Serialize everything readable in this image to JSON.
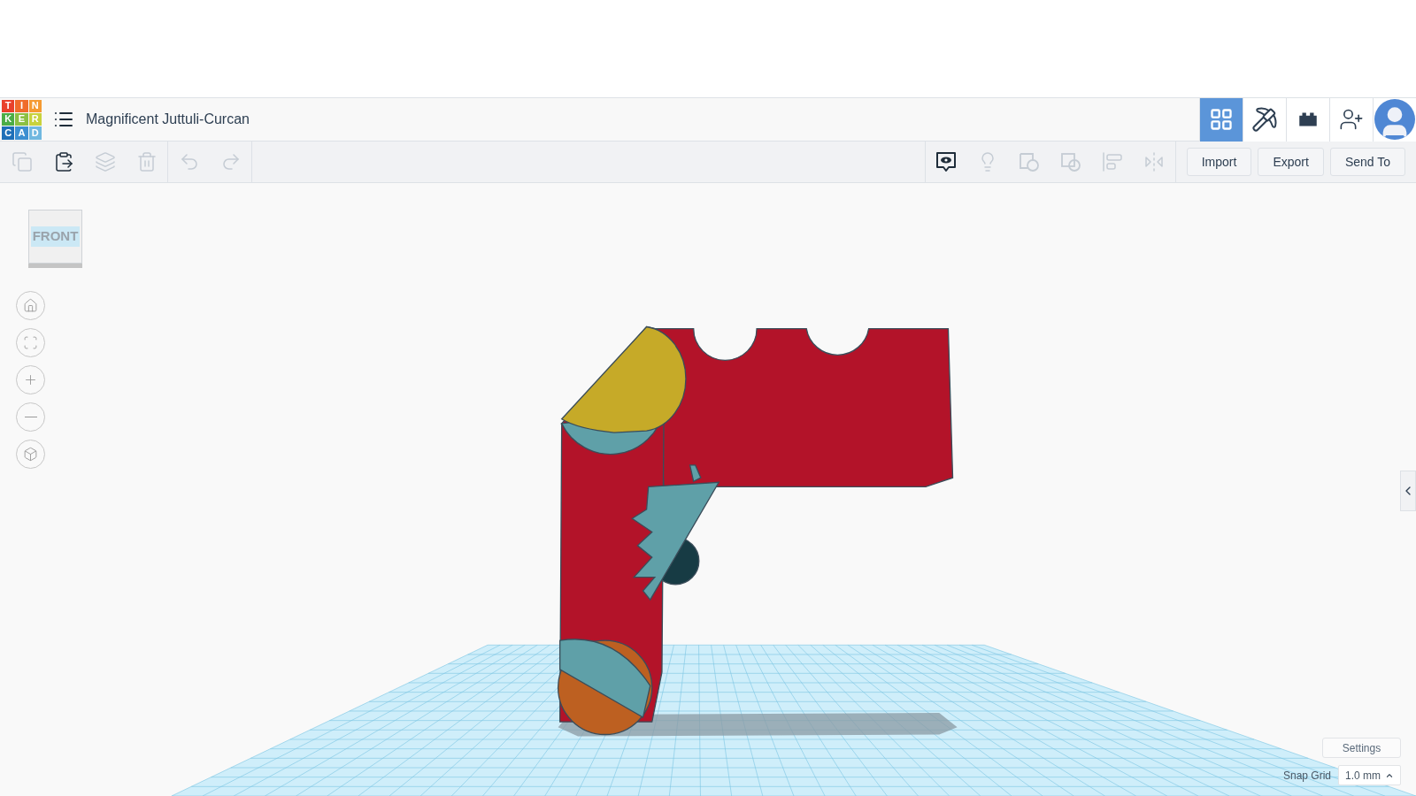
{
  "logo": {
    "tiles": [
      {
        "letter": "T",
        "color": "#e9412b"
      },
      {
        "letter": "I",
        "color": "#f06b2b"
      },
      {
        "letter": "N",
        "color": "#f59a32"
      },
      {
        "letter": "K",
        "color": "#4cad47"
      },
      {
        "letter": "E",
        "color": "#8cc043"
      },
      {
        "letter": "R",
        "color": "#c8d23c"
      },
      {
        "letter": "C",
        "color": "#1e6fb8"
      },
      {
        "letter": "A",
        "color": "#3d8fd1"
      },
      {
        "letter": "D",
        "color": "#70b8e0"
      }
    ]
  },
  "project_title": "Magnificent Juttuli-Curcan",
  "nav": [
    {
      "kind": "grid",
      "selected": true
    },
    {
      "kind": "pickaxe",
      "selected": false
    },
    {
      "kind": "brick",
      "selected": false
    },
    {
      "kind": "add-user",
      "selected": false
    },
    {
      "kind": "avatar",
      "selected": false
    }
  ],
  "edit_tools": [
    {
      "kind": "copy",
      "disabled": true
    },
    {
      "kind": "paste",
      "disabled": false
    },
    {
      "kind": "duplicate",
      "disabled": true
    },
    {
      "kind": "delete",
      "disabled": true
    },
    {
      "kind": "undo",
      "disabled": true
    },
    {
      "kind": "redo",
      "disabled": true
    }
  ],
  "shape_tools": [
    {
      "kind": "notes",
      "disabled": false
    },
    {
      "kind": "light",
      "disabled": true
    },
    {
      "kind": "group",
      "disabled": true
    },
    {
      "kind": "ungroup",
      "disabled": true
    },
    {
      "kind": "align",
      "disabled": true
    },
    {
      "kind": "mirror",
      "disabled": true
    }
  ],
  "buttons": [
    "Import",
    "Export",
    "Send To"
  ],
  "view_cube": {
    "label": "FRONT"
  },
  "view_controls": [
    {
      "kind": "home"
    },
    {
      "kind": "fit"
    },
    {
      "kind": "zoom-in"
    },
    {
      "kind": "zoom-out"
    },
    {
      "kind": "ortho"
    }
  ],
  "settings_button": "Settings",
  "snap_grid": {
    "label": "Snap Grid",
    "value": "1.0 mm"
  }
}
